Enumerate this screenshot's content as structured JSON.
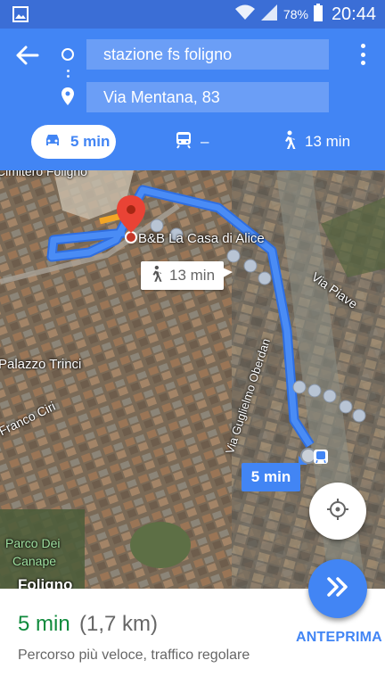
{
  "status_bar": {
    "battery_percent": "78%",
    "time": "20:44",
    "icons": [
      "gallery-icon",
      "wifi-icon",
      "signal-icon",
      "battery-icon"
    ]
  },
  "directions": {
    "origin": "stazione fs foligno",
    "destination": "Via Mentana, 83",
    "modes": {
      "car": "5 min",
      "transit": "–",
      "walk": "13 min"
    }
  },
  "map": {
    "labels": {
      "cimitero": "Cimitero Foligno",
      "franco_ciri": "Franco Ciri",
      "palazzo_trinci": "Palazzo Trinci",
      "parco": "Parco Dei",
      "canape": "Canape",
      "foligno": "Foligno",
      "oberdan": "Via Guglielmo Oberdan",
      "piave": "Via Piave",
      "bb": "B&B La Casa di Alice"
    },
    "walk_bubble": "13 min",
    "drive_bubble": "5 min",
    "colors": {
      "route": "#4285f4",
      "walk_dots": "#b8c4d4"
    }
  },
  "summary": {
    "time": "5 min",
    "distance": "(1,7 km)",
    "subtitle": "Percorso più veloce, traffico regolare",
    "preview_label": "ANTEPRIMA"
  },
  "colors": {
    "header": "#4285f4",
    "statusbar": "#3b6ed6",
    "accent_green": "#0f8a3c"
  }
}
